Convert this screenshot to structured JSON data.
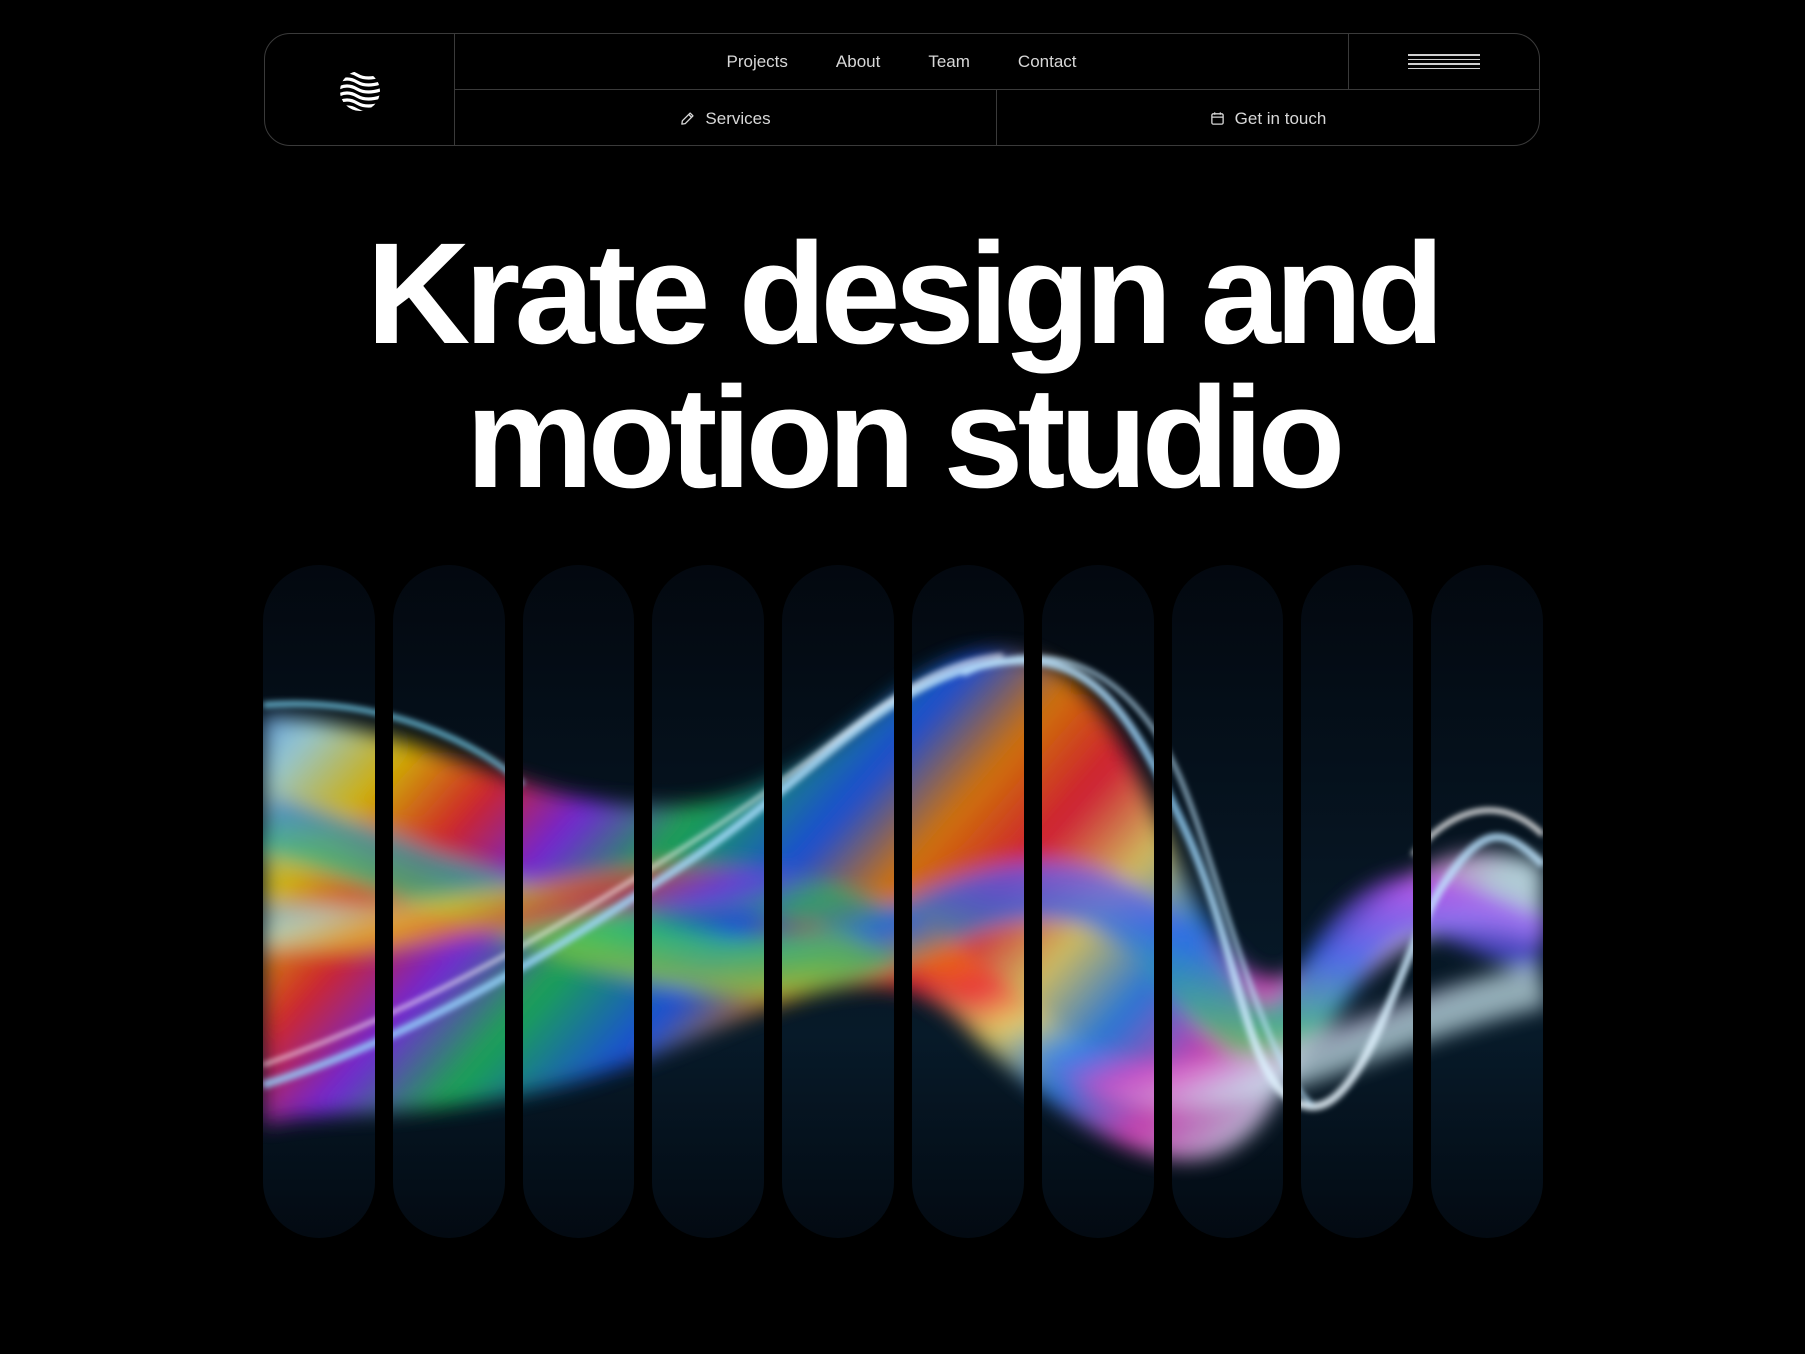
{
  "nav": {
    "links": [
      "Projects",
      "About",
      "Team",
      "Contact"
    ],
    "services_label": "Services",
    "contact_label": "Get in touch",
    "icons": {
      "logo": "wave-sphere-icon",
      "menu": "hamburger-icon",
      "services": "pencil-icon",
      "contact": "calendar-icon"
    }
  },
  "hero": {
    "line1": "Krate design and",
    "line2": "motion studio"
  },
  "colors": {
    "background": "#000000",
    "border": "#3a3a3a",
    "text": "#ffffff",
    "nav_text": "#d8d8d8",
    "pill_bg": "#061522"
  },
  "gallery": {
    "pill_count": 10,
    "image": "iridescent-glass-ribbon"
  }
}
